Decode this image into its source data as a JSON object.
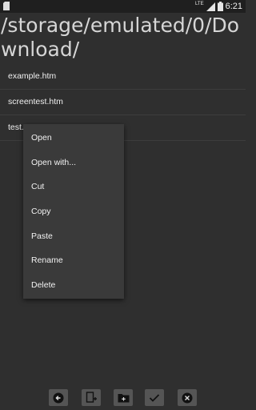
{
  "status_bar": {
    "time": "6:21",
    "network_label": "LTE",
    "icons": [
      "sd-card-icon",
      "signal-icon",
      "battery-icon"
    ]
  },
  "header": {
    "path": "/storage/emulated/0/Download/"
  },
  "files": [
    {
      "name": "example.htm"
    },
    {
      "name": "screentest.htm"
    },
    {
      "name": "test.t"
    }
  ],
  "context_menu": {
    "items": [
      {
        "label": "Open"
      },
      {
        "label": "Open with..."
      },
      {
        "label": "Cut"
      },
      {
        "label": "Copy"
      },
      {
        "label": "Paste"
      },
      {
        "label": "Rename"
      },
      {
        "label": "Delete"
      }
    ]
  },
  "toolbar": {
    "buttons": [
      {
        "icon": "back-arrow-icon"
      },
      {
        "icon": "new-file-icon"
      },
      {
        "icon": "new-folder-icon"
      },
      {
        "icon": "check-icon"
      },
      {
        "icon": "close-icon"
      }
    ]
  }
}
